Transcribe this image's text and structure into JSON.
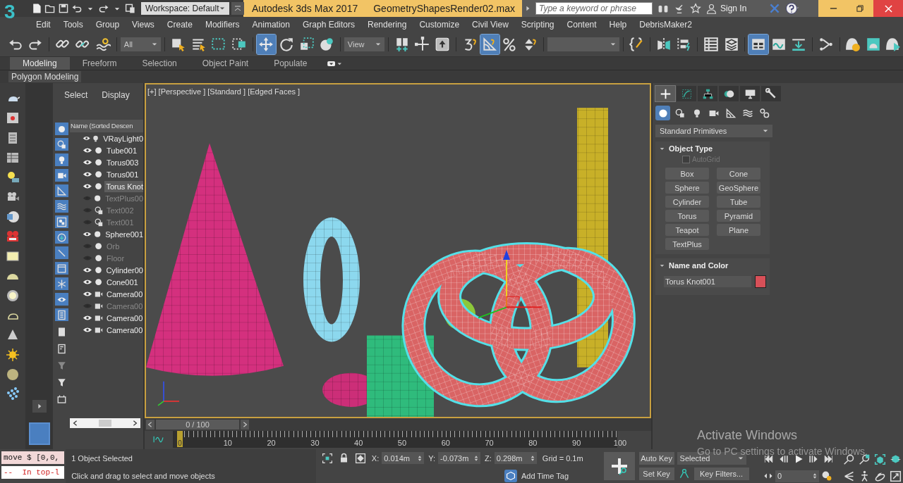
{
  "title_bar": {
    "logo": "3",
    "workspace": "Workspace: Default",
    "app_title": "Autodesk 3ds Max 2017",
    "file_name": "GeometryShapesRender02.max",
    "search": {
      "placeholder": "Type a keyword or phrase"
    },
    "sign_in": "Sign In"
  },
  "menu": [
    "Edit",
    "Tools",
    "Group",
    "Views",
    "Create",
    "Modifiers",
    "Animation",
    "Graph Editors",
    "Rendering",
    "Customize",
    "Civil View",
    "Scripting",
    "Content",
    "Help",
    "DebrisMaker2"
  ],
  "main_toolbar": {
    "selection_filter": "All",
    "reference_coordinate": "View",
    "buttons": [
      {
        "selected": false
      },
      {
        "selected": false
      },
      {
        "selected": false
      },
      {
        "selected": false
      },
      {
        "selected": false
      },
      {
        "selected": false
      },
      {
        "selected": false
      },
      {
        "selected": false
      },
      {
        "selected": false
      },
      {
        "selected": true
      },
      {
        "selected": false
      },
      {
        "selected": false
      },
      {
        "selected": false
      },
      {
        "selected": false
      },
      {
        "selected": false
      },
      {
        "selected": false
      },
      {
        "selected": false
      },
      {
        "selected": true
      },
      {
        "selected": false
      },
      {
        "selected": false
      },
      {
        "selected": false
      },
      {
        "selected": false
      },
      {
        "selected": false
      },
      {
        "selected": false
      },
      {
        "selected": false
      },
      {
        "selected": true
      },
      {
        "selected": false
      },
      {
        "selected": false
      },
      {
        "selected": false
      },
      {
        "selected": false
      },
      {
        "selected": false
      },
      {
        "selected": false
      }
    ]
  },
  "ribbon": {
    "tabs": [
      {
        "label": "Modeling",
        "selected": true
      },
      {
        "label": "Freeform",
        "selected": false
      },
      {
        "label": "Selection",
        "selected": false
      },
      {
        "label": "Object Paint",
        "selected": false
      },
      {
        "label": "Populate",
        "selected": false
      }
    ],
    "panel": "Polygon Modeling"
  },
  "scene_explorer": {
    "tabs": [
      "Select",
      "Display"
    ],
    "column_header": "Name (Sorted Descen",
    "objects": [
      {
        "name": "VRayLight0",
        "kind": "light",
        "visible": true,
        "selected": false
      },
      {
        "name": "Tube001",
        "kind": "geometry",
        "visible": true,
        "selected": false
      },
      {
        "name": "Torus003",
        "kind": "geometry",
        "visible": true,
        "selected": false
      },
      {
        "name": "Torus001",
        "kind": "geometry",
        "visible": true,
        "selected": false
      },
      {
        "name": "Torus Knot",
        "kind": "geometry",
        "visible": true,
        "selected": true
      },
      {
        "name": "TextPlus00",
        "kind": "geometry",
        "visible": false,
        "selected": false
      },
      {
        "name": "Text002",
        "kind": "shape",
        "visible": false,
        "selected": false
      },
      {
        "name": "Text001",
        "kind": "shape",
        "visible": false,
        "selected": false
      },
      {
        "name": "Sphere001",
        "kind": "geometry",
        "visible": true,
        "selected": false
      },
      {
        "name": "Orb",
        "kind": "geometry",
        "visible": false,
        "selected": false
      },
      {
        "name": "Floor",
        "kind": "geometry",
        "visible": false,
        "selected": false
      },
      {
        "name": "Cylinder00",
        "kind": "geometry",
        "visible": true,
        "selected": false
      },
      {
        "name": "Cone001",
        "kind": "geometry",
        "visible": true,
        "selected": false
      },
      {
        "name": "Camera00",
        "kind": "camera",
        "visible": true,
        "selected": false
      },
      {
        "name": "Camera00",
        "kind": "camera",
        "visible": false,
        "selected": false
      },
      {
        "name": "Camera00",
        "kind": "camera",
        "visible": true,
        "selected": false
      },
      {
        "name": "Camera00",
        "kind": "camera",
        "visible": true,
        "selected": false
      }
    ]
  },
  "viewport": {
    "label": "[+] [Perspective ] [Standard ] [Edged Faces ]"
  },
  "command_panel": {
    "tabs": [
      {
        "selected": true
      },
      {
        "selected": false
      },
      {
        "selected": false
      },
      {
        "selected": false
      },
      {
        "selected": false
      },
      {
        "selected": false
      }
    ],
    "categories": [
      {
        "selected": true
      },
      {
        "selected": false
      },
      {
        "selected": false
      },
      {
        "selected": false
      },
      {
        "selected": false
      },
      {
        "selected": false
      },
      {
        "selected": false
      }
    ],
    "dropdown": "Standard Primitives",
    "object_type": {
      "title": "Object Type",
      "autogrid": {
        "label": "AutoGrid",
        "checked": false,
        "disabled": true
      },
      "buttons": [
        "Box",
        "Cone",
        "Sphere",
        "GeoSphere",
        "Cylinder",
        "Tube",
        "Torus",
        "Pyramid",
        "Teapot",
        "Plane",
        "TextPlus"
      ]
    },
    "name_and_color": {
      "title": "Name and Color",
      "name": "Torus Knot001"
    }
  },
  "time_slider": {
    "label": "0 / 100"
  },
  "track_bar": {
    "thumb": "0",
    "labels": [
      "10",
      "20",
      "30",
      "40",
      "50",
      "60",
      "70",
      "80",
      "90",
      "100"
    ]
  },
  "status_bar": {
    "listener": [
      "move $ [0,0,",
      "--  In top-l"
    ],
    "selection": "1 Object Selected",
    "prompt": "Click and drag to select and move objects",
    "coordinates": [
      {
        "label": "X:",
        "value": "0.014m"
      },
      {
        "label": "Y:",
        "value": "-0.073m"
      },
      {
        "label": "Z:",
        "value": "0.298m"
      }
    ],
    "grid": "Grid = 0.1m",
    "time_tag": "Add Time Tag",
    "auto_key": "Auto Key",
    "key_mode": "Selected",
    "set_key": "Set Key",
    "key_filters": "Key Filters...",
    "frame": "0"
  },
  "os_notice": {
    "title": "Activate Windows",
    "message": "Go to PC settings to activate Windows."
  }
}
